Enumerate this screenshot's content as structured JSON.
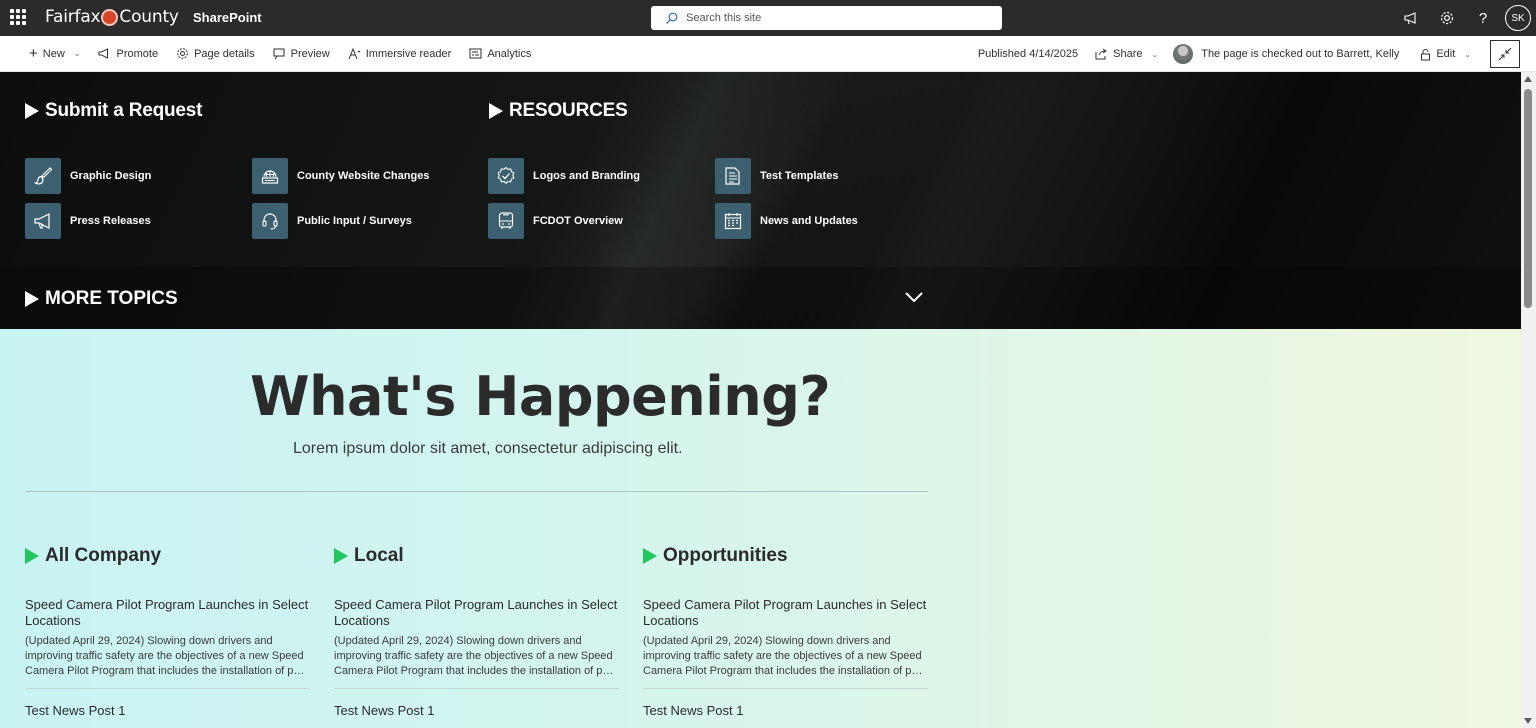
{
  "suitebar": {
    "brand_left": "Fairfax",
    "brand_right": "County",
    "app_name": "SharePoint",
    "search_placeholder": "Search this site",
    "user_initials": "SK",
    "icons": [
      "waffle-icon",
      "megaphone-icon",
      "gear-icon",
      "help-icon"
    ]
  },
  "command_bar": {
    "new": "New",
    "promote": "Promote",
    "page_details": "Page details",
    "preview": "Preview",
    "immersive_reader": "Immersive reader",
    "analytics": "Analytics",
    "published": "Published 4/14/2025",
    "share": "Share",
    "checked_out": "The page is checked out to Barrett, Kelly",
    "edit": "Edit"
  },
  "hero": {
    "submit_heading": "Submit a Request",
    "resources_heading": "RESOURCES",
    "more_topics": "MORE TOPICS",
    "tiles": [
      {
        "label": "Graphic Design",
        "icon": "paintbrush-icon"
      },
      {
        "label": "County Website Changes",
        "icon": "globe-icon"
      },
      {
        "label": "Logos and Branding",
        "icon": "badge-check-icon"
      },
      {
        "label": "Test Templates",
        "icon": "document-icon"
      },
      {
        "label": "Press Releases",
        "icon": "megaphone-icon"
      },
      {
        "label": "Public Input / Surveys",
        "icon": "headset-icon"
      },
      {
        "label": "FCDOT Overview",
        "icon": "bus-icon"
      },
      {
        "label": "News and Updates",
        "icon": "calendar-icon"
      }
    ]
  },
  "happening": {
    "title": "What's Happening?",
    "subtitle": "Lorem ipsum dolor sit amet, consectetur adipiscing elit."
  },
  "news_columns": [
    {
      "heading": "All Company",
      "item_title": "Speed Camera Pilot Program Launches in Select Locations",
      "item_desc_1": "(Updated April 29, 2024) Slowing down drivers and",
      "item_desc_2": "improving traffic safety are the objectives of a new Speed",
      "item_desc_3": "Camera Pilot Program that includes the installation of phot...",
      "next_title": "Test News Post 1"
    },
    {
      "heading": "Local",
      "item_title": "Speed Camera Pilot Program Launches in Select Locations",
      "item_desc_1": "(Updated April 29, 2024) Slowing down drivers and",
      "item_desc_2": "improving traffic safety are the objectives of a new Speed",
      "item_desc_3": "Camera Pilot Program that includes the installation of phot...",
      "next_title": "Test News Post 1"
    },
    {
      "heading": "Opportunities",
      "item_title": "Speed Camera Pilot Program Launches in Select Locations",
      "item_desc_1": "(Updated April 29, 2024) Slowing down drivers and",
      "item_desc_2": "improving traffic safety are the objectives of a new Speed",
      "item_desc_3": "Camera Pilot Program that includes the installation of phot...",
      "next_title": "Test News Post 1"
    }
  ],
  "colors": {
    "suitebar_bg": "#2b2b2b",
    "tile_icon_bg": "#3d6071",
    "green_accent": "#22c55e"
  }
}
